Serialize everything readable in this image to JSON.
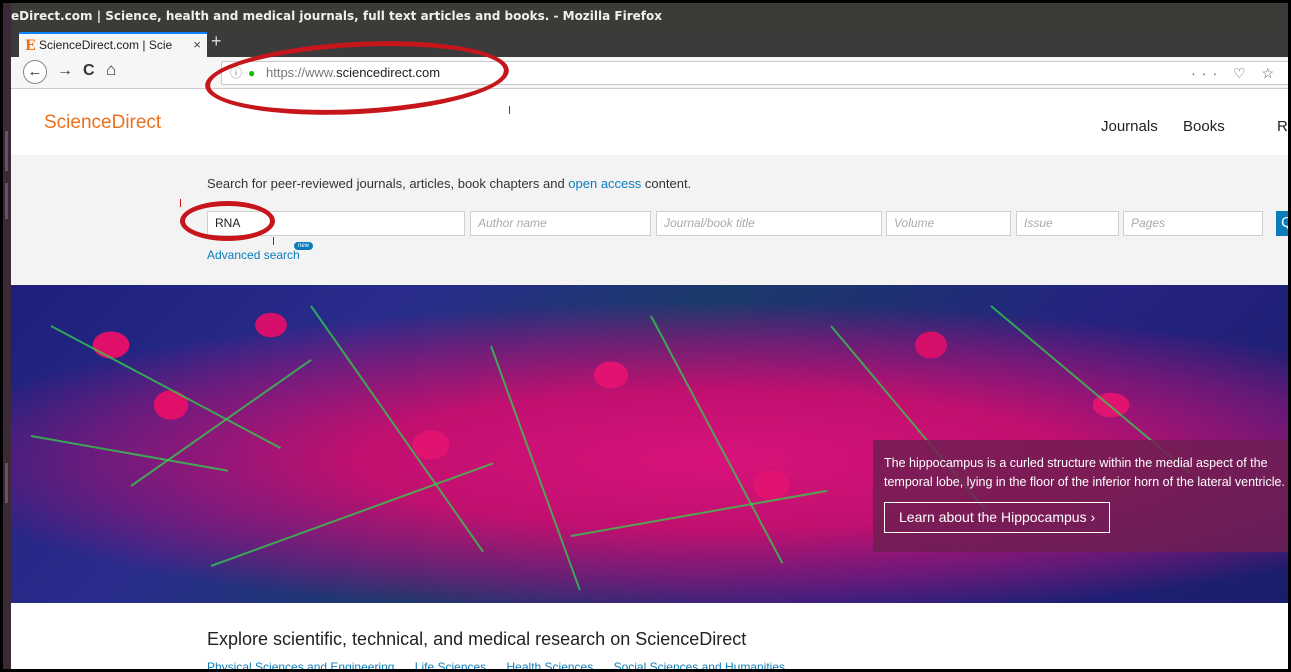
{
  "window": {
    "title": "eDirect.com | Science, health and medical journals, full text articles and books. - Mozilla Firefox"
  },
  "tab": {
    "label": "ScienceDirect.com | Scie",
    "favicon": "E",
    "close": "×",
    "new_tab": "+"
  },
  "navbar": {
    "back": "←",
    "forward": "→",
    "reload": "C",
    "home": "⌂",
    "info": "ⓘ",
    "lock": "🔒",
    "url_prefix": "https://www.",
    "url_domain": "sciencedirect.com",
    "tools": "··· ♡ ☆"
  },
  "site": {
    "logo": "ScienceDirect",
    "nav": [
      "Journals",
      "Books",
      "Re"
    ]
  },
  "search": {
    "intro_before": "Search for peer-reviewed journals, articles, book chapters and ",
    "intro_link": "open access",
    "intro_after": " content.",
    "keywords": "RNA",
    "author_placeholder": "Author name",
    "journal_placeholder": "Journal/book title",
    "volume_placeholder": "Volume",
    "issue_placeholder": "Issue",
    "pages_placeholder": "Pages",
    "search_icon": "Q",
    "advanced": "Advanced search",
    "new_badge": "new"
  },
  "hero": {
    "caption": "The hippocampus is a curled structure within the medial aspect of the temporal lobe, lying in the floor of the inferior horn of the lateral ventricle.",
    "button": "Learn about the Hippocampus ›"
  },
  "explore": {
    "heading": "Explore scientific, technical, and medical research on ScienceDirect",
    "subjects": [
      "Physical Sciences and Engineering",
      "Life Sciences",
      "Health Sciences",
      "Social Sciences and Humanities"
    ]
  },
  "colors": {
    "brand": "#e9711c",
    "link": "#0c7dbb",
    "annotation": "#c6161c"
  }
}
